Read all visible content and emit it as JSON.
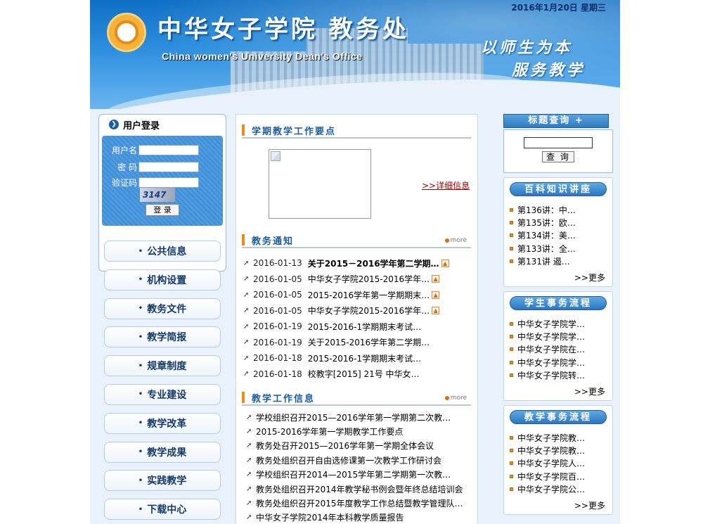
{
  "banner": {
    "date": "2016年1月20日 星期三",
    "title_cn": "中华女子学院  教务处",
    "title_en": "China women's University Dean's  Office",
    "slogan_line1": "以师生为本",
    "slogan_line2": "服务教学"
  },
  "login": {
    "title": "用户登录",
    "username_label": "用户名",
    "password_label": "密    码",
    "captcha_label": "验证码",
    "captcha_text": "3147",
    "submit_label": "登  录"
  },
  "nav": [
    {
      "label": "公共信息"
    },
    {
      "label": "机构设置"
    },
    {
      "label": "教务文件"
    },
    {
      "label": "教学简报"
    },
    {
      "label": "规章制度"
    },
    {
      "label": "专业建设"
    },
    {
      "label": "教学改革"
    },
    {
      "label": "教学成果"
    },
    {
      "label": "实践教学"
    },
    {
      "label": "下载中心"
    }
  ],
  "center": {
    "section1_title": "学期教学工作要点",
    "detail_link": ">>详细信息",
    "section2_title": "教务通知",
    "section3_title": "教学工作信息",
    "more_label": "more",
    "notices": [
      {
        "date": "2016-01-13",
        "title": "关于2015－2016学年第二学期…",
        "bold": true,
        "new": true
      },
      {
        "date": "2016-01-05",
        "title": "中华女子学院2015-2016学年…",
        "bold": false,
        "new": true
      },
      {
        "date": "2016-01-05",
        "title": "2015-2016学年第一学期期末…",
        "bold": false,
        "new": true
      },
      {
        "date": "2016-01-05",
        "title": "中华女子学院2015-2016学年…",
        "bold": false,
        "new": true
      },
      {
        "date": "2016-01-19",
        "title": "2015-2016-1学期期末考试…",
        "bold": false,
        "new": false
      },
      {
        "date": "2016-01-19",
        "title": "关于2015-2016学年第二学期…",
        "bold": false,
        "new": false
      },
      {
        "date": "2016-01-18",
        "title": "2015-2016-1学期期末考试…",
        "bold": false,
        "new": false
      },
      {
        "date": "2016-01-18",
        "title": "校教字[2015] 21号 中华女…",
        "bold": false,
        "new": false
      }
    ],
    "info": [
      "学校组织召开2015—2016学年第一学期第二次教…",
      "2015-2016学年第一学期教学工作要点",
      "教务处召开2015—2016学年第一学期全体会议",
      "教务处组织召开自由选修课第一次教学工作研讨会",
      "学校组织召开2014—2015学年第二学期第一次教…",
      "教务处组织召开2014年教学秘书例会暨年终总结培训会",
      "教务处组织召开2015年度教学工作总结暨教学管理队…",
      "中华女子学院2014年本科教学质量报告"
    ]
  },
  "right": {
    "search_title": "标题查询",
    "search_button": "查 询",
    "box1": {
      "title": "百科知识讲座",
      "items": [
        "第136讲：中…",
        "第135讲：欧…",
        "第134讲：美…",
        "第133讲：全…",
        "第131讲 遏…"
      ]
    },
    "box2": {
      "title": "学生事务流程",
      "items": [
        "中华女子学院学…",
        "中华女子学院学…",
        "中华女子学院在…",
        "中华女子学院学…",
        "中华女子学院转…"
      ]
    },
    "box3": {
      "title": "教学事务流程",
      "items": [
        "中华女子学院教…",
        "中华女子学院教…",
        "中华女子学院人…",
        "中华女子学院百…",
        "中华女子学院公…"
      ]
    },
    "more_label": ">>更多"
  }
}
